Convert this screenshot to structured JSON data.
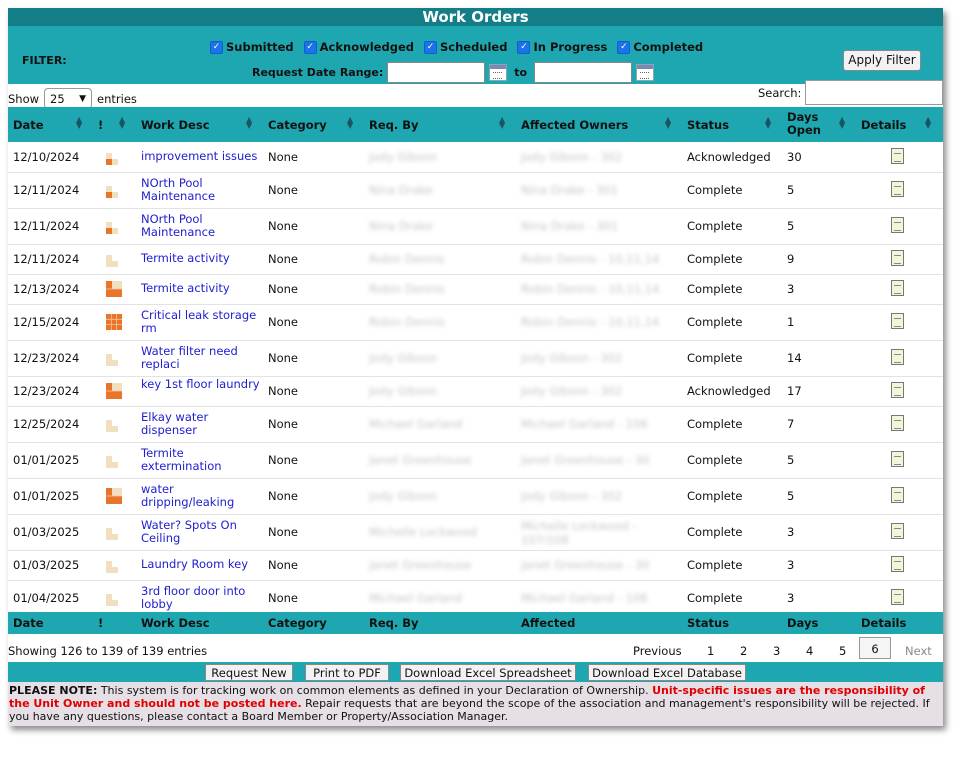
{
  "title": "Work Orders",
  "filter": {
    "label": "FILTER:",
    "statuses": [
      {
        "label": "Submitted",
        "checked": true
      },
      {
        "label": "Acknowledged",
        "checked": true
      },
      {
        "label": "Scheduled",
        "checked": true
      },
      {
        "label": "In Progress",
        "checked": true
      },
      {
        "label": "Completed",
        "checked": true
      }
    ],
    "date_range_label": "Request Date Range:",
    "to_label": "to",
    "start_date": "",
    "end_date": "",
    "apply_label": "Apply Filter"
  },
  "entries": {
    "show_label": "Show",
    "value": "25",
    "suffix": "entries"
  },
  "search": {
    "label": "Search:",
    "value": ""
  },
  "columns": [
    "Date",
    "!",
    "Work Desc",
    "Category",
    "Req. By",
    "Affected Owners",
    "Status",
    "Days Open",
    "Details"
  ],
  "footer_columns": [
    "Date",
    "!",
    "Work Desc",
    "Category",
    "Req. By",
    "Affected",
    "Status",
    "Days",
    "Details"
  ],
  "rows": [
    {
      "date": "12/10/2024",
      "priority": "low",
      "desc": "improvement issues",
      "category": "None",
      "req_by": "Jody Gibson",
      "affected": "Jody Gibson - 302",
      "status": "Acknowledged",
      "days": "30"
    },
    {
      "date": "12/11/2024",
      "priority": "low",
      "desc": "NOrth Pool Maintenance",
      "category": "None",
      "req_by": "Nina Drake",
      "affected": "Nina Drake - 301",
      "status": "Complete",
      "days": "5"
    },
    {
      "date": "12/11/2024",
      "priority": "low",
      "desc": "NOrth Pool Maintenance",
      "category": "None",
      "req_by": "Nina Drake",
      "affected": "Nina Drake - 301",
      "status": "Complete",
      "days": "5"
    },
    {
      "date": "12/11/2024",
      "priority": "none",
      "desc": "Termite activity",
      "category": "None",
      "req_by": "Robin Dennis",
      "affected": "Robin Dennis - 10,11,14",
      "status": "Complete",
      "days": "9"
    },
    {
      "date": "12/13/2024",
      "priority": "medium",
      "desc": "Termite activity",
      "category": "None",
      "req_by": "Robin Dennis",
      "affected": "Robin Dennis - 10,11,14",
      "status": "Complete",
      "days": "3"
    },
    {
      "date": "12/15/2024",
      "priority": "high",
      "desc": "Critical leak storage rm",
      "category": "None",
      "req_by": "Robin Dennis",
      "affected": "Robin Dennis - 10,11,14",
      "status": "Complete",
      "days": "1"
    },
    {
      "date": "12/23/2024",
      "priority": "none",
      "desc": "Water filter need replaci",
      "category": "None",
      "req_by": "Jody Gibson",
      "affected": "Jody Gibson - 302",
      "status": "Complete",
      "days": "14"
    },
    {
      "date": "12/23/2024",
      "priority": "medium",
      "desc": "key 1st floor laundry",
      "category": "None",
      "req_by": "Jody Gibson",
      "affected": "Jody Gibson - 302",
      "status": "Acknowledged",
      "days": "17"
    },
    {
      "date": "12/25/2024",
      "priority": "none",
      "desc": "Elkay water dispenser",
      "category": "None",
      "req_by": "Michael Garland",
      "affected": "Michael Garland - 106",
      "status": "Complete",
      "days": "7"
    },
    {
      "date": "01/01/2025",
      "priority": "none",
      "desc": "Termite extermination",
      "category": "None",
      "req_by": "Janet Greenhouse",
      "affected": "Janet Greenhouse - 30",
      "status": "Complete",
      "days": "5"
    },
    {
      "date": "01/01/2025",
      "priority": "medium",
      "desc": "water dripping/leaking",
      "category": "None",
      "req_by": "Jody Gibson",
      "affected": "Jody Gibson - 302",
      "status": "Complete",
      "days": "5"
    },
    {
      "date": "01/03/2025",
      "priority": "none",
      "desc": "Water? Spots On Ceiling",
      "category": "None",
      "req_by": "Michelle Lockwood",
      "affected": "Michelle Lockwood - 107/108",
      "status": "Complete",
      "days": "3"
    },
    {
      "date": "01/03/2025",
      "priority": "none",
      "desc": "Laundry Room key",
      "category": "None",
      "req_by": "Janet Greenhouse",
      "affected": "Janet Greenhouse - 30",
      "status": "Complete",
      "days": "3"
    },
    {
      "date": "01/04/2025",
      "priority": "none",
      "desc": "3rd floor door into lobby",
      "category": "None",
      "req_by": "Michael Garland",
      "affected": "Michael Garland - 106",
      "status": "Complete",
      "days": "3"
    }
  ],
  "pagination": {
    "showing": "Showing 126 to 139 of 139 entries",
    "previous": "Previous",
    "pages": [
      "1",
      "2",
      "3",
      "4",
      "5",
      "6"
    ],
    "current": "6",
    "next": "Next"
  },
  "actions": [
    "Request New",
    "Print to PDF",
    "Download Excel Spreadsheet",
    "Download Excel Database"
  ],
  "note": {
    "lead": "PLEASE NOTE:",
    "text1": " This system is for tracking work on common elements as defined in your Declaration of Ownership. ",
    "red": "Unit-specific issues are the responsibility of the Unit Owner and should not be posted here.",
    "text2": " Repair requests that are beyond the scope of the association and management's responsibility will be rejected. If you have any questions, please contact a Board Member or Property/Association Manager."
  },
  "colors": {
    "header": "#1fa7b1",
    "title": "#147e88",
    "link": "#2020d0",
    "warning": "#e00000",
    "priority_orange": "#e8752a",
    "priority_beige": "#f2dfc0"
  }
}
